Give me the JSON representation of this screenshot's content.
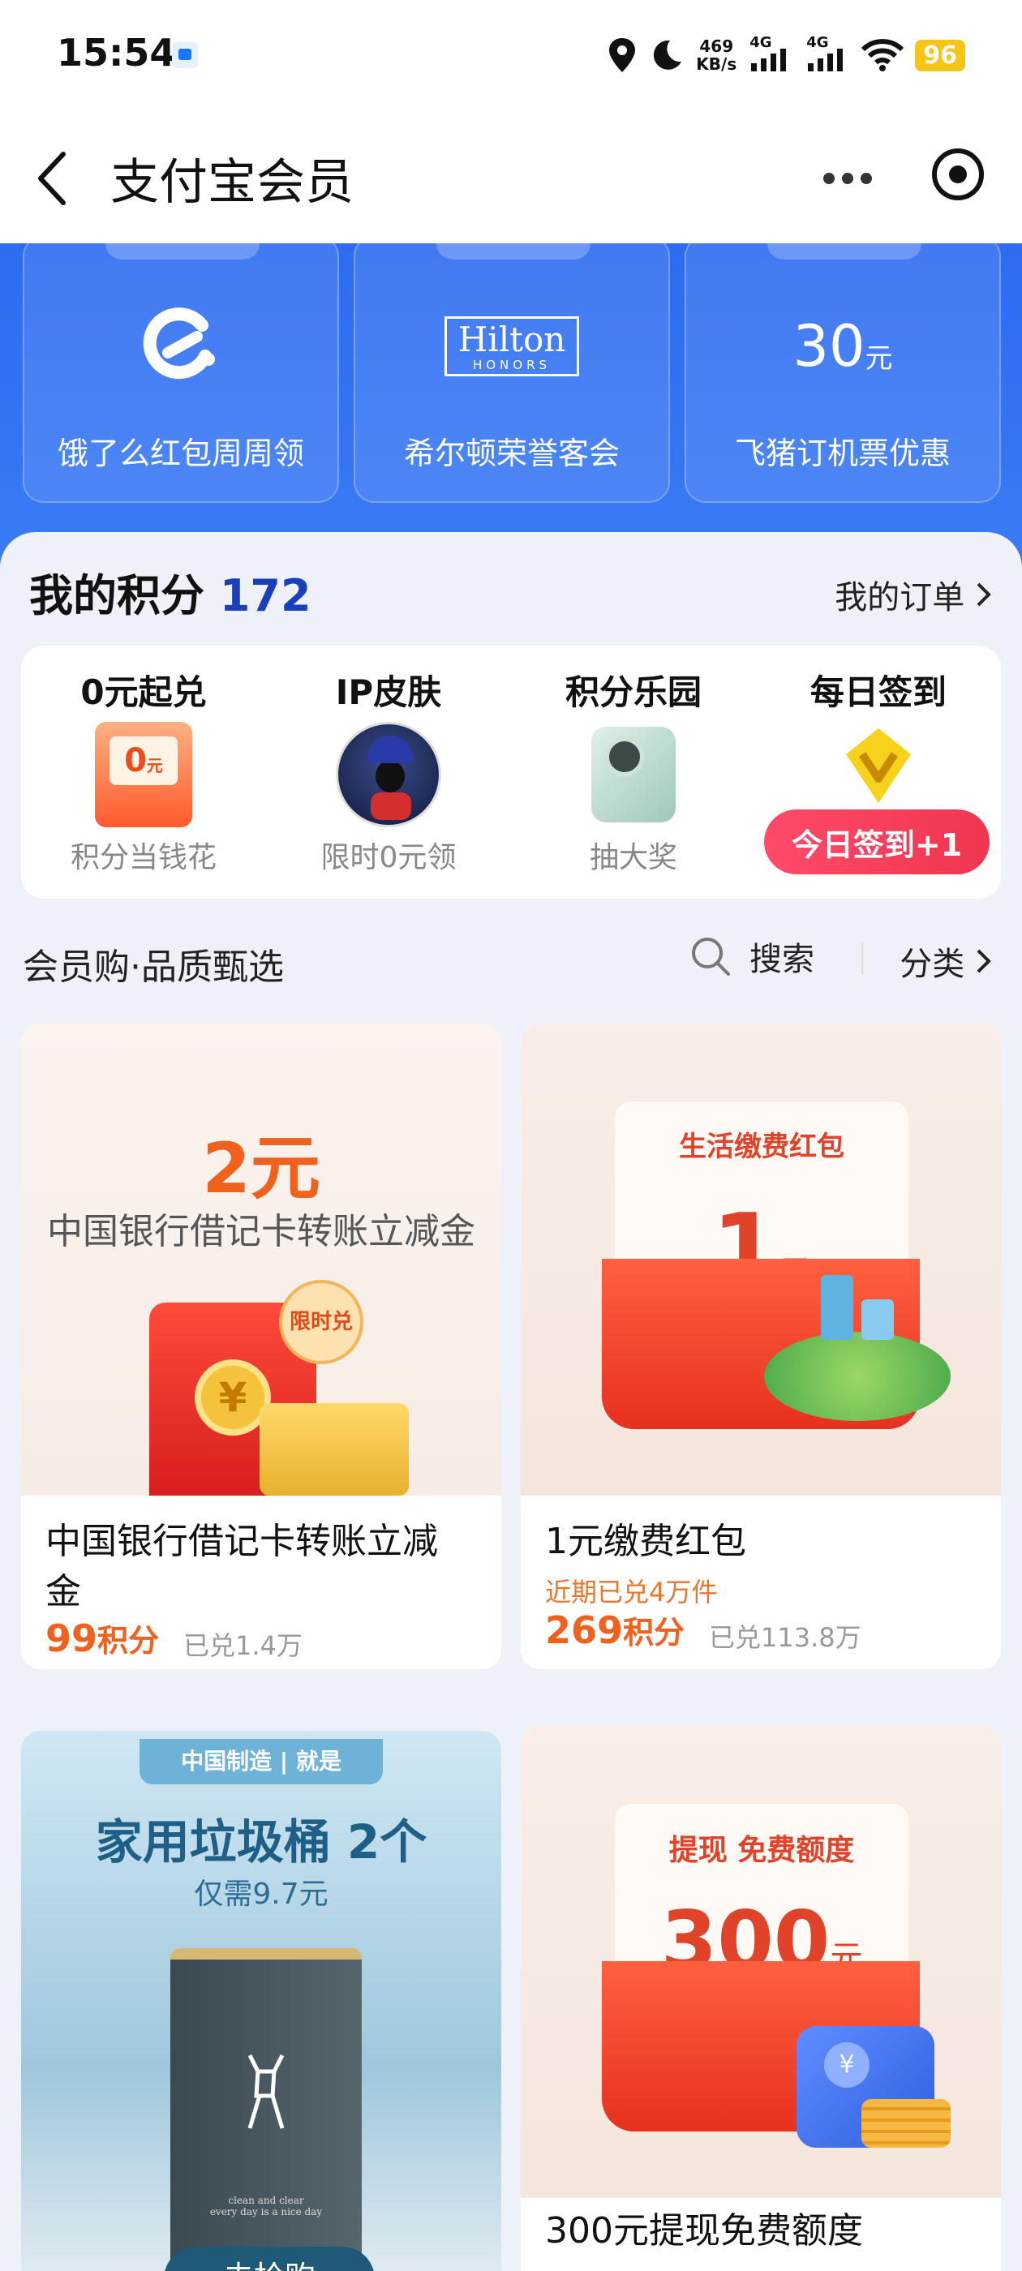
{
  "status_bar": {
    "time": "15:54",
    "speed_value": "469",
    "speed_unit": "KB/s",
    "net1": "4G",
    "net2": "4G",
    "battery": "96"
  },
  "header": {
    "title": "支付宝会员"
  },
  "banner": {
    "perks": [
      {
        "label": "饿了么红包周周领",
        "logo": "eleme-logo"
      },
      {
        "label": "希尔顿荣誉客会",
        "logo": "hilton-logo",
        "logo_text": "Hilton",
        "logo_sub": "HONORS"
      },
      {
        "label": "飞猪订机票优惠",
        "logo": "coupon-30",
        "logo_num": "30",
        "logo_unit": "元"
      }
    ]
  },
  "points": {
    "title": "我的积分",
    "value": "172",
    "orders_label": "我的订单",
    "benefits": [
      {
        "title": "0元起兑",
        "sub": "积分当钱花",
        "icon_text": "0",
        "icon_unit": "元"
      },
      {
        "title": "IP皮肤",
        "sub": "限时0元领"
      },
      {
        "title": "积分乐园",
        "sub": "抽大奖"
      },
      {
        "title": "每日签到",
        "sub": ""
      }
    ],
    "signin_label": "今日签到+1"
  },
  "shop": {
    "title": "会员购·品质甄选",
    "search_label": "搜索",
    "category_label": "分类"
  },
  "products": [
    {
      "banner_amount": "2元",
      "banner_desc": "中国银行借记卡转账立减金",
      "badge": "限时兑",
      "coin": "¥",
      "name_line1": "中国银行借记卡转账立减",
      "name_line2": "金",
      "price": "99",
      "price_unit": "积分",
      "sold": "已兑1.4万"
    },
    {
      "banner_title": "生活缴费红包",
      "banner_num": "1",
      "banner_unit": "元",
      "name_line1": "1元缴费红包",
      "hot": "近期已兑4万件",
      "price": "269",
      "price_unit": "积分",
      "sold": "已兑113.8万"
    },
    {
      "banner_tag_a": "中国制造",
      "banner_tag_b": "就是",
      "banner_headline": "家用垃圾桶 2个",
      "banner_price": "仅需9.7元",
      "bin_print_1": "clean and clear",
      "bin_print_2": "every day is a nice day",
      "cta": "去抢购"
    },
    {
      "banner_title": "提现 免费额度",
      "banner_num": "300",
      "banner_unit": "元",
      "coin": "¥",
      "name_line1": "300元提现免费额度"
    }
  ]
}
